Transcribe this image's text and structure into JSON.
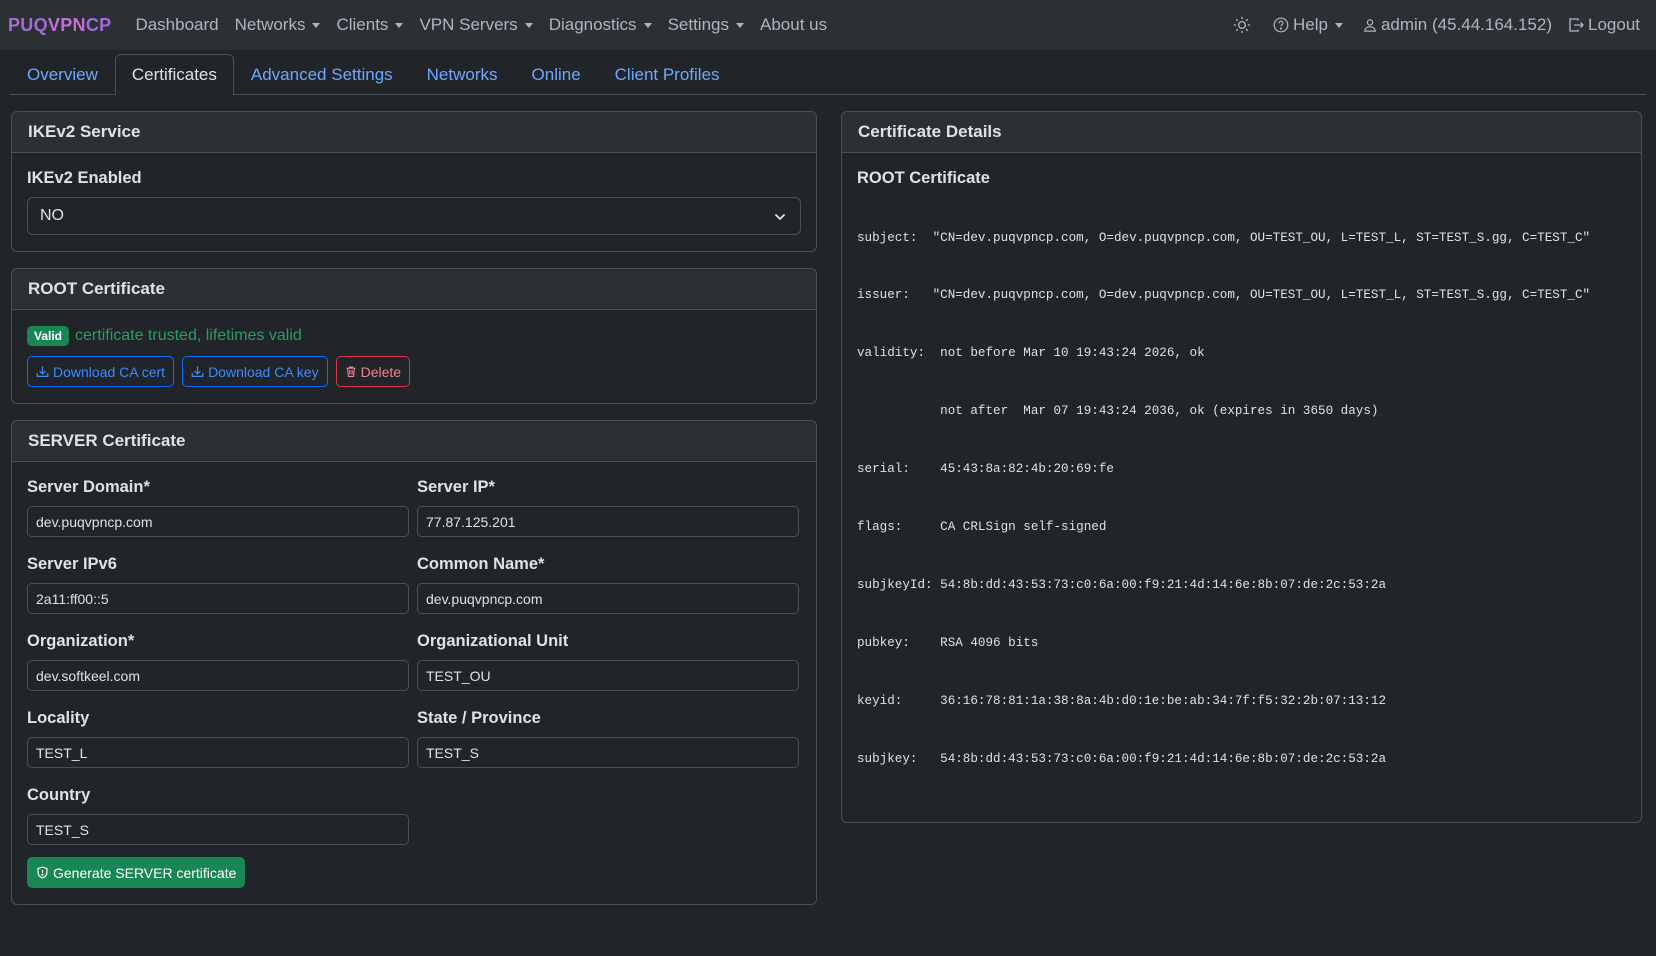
{
  "brand": {
    "part1": "PUQ",
    "part2": "VPN",
    "part3": "CP"
  },
  "nav": {
    "items": [
      {
        "label": "Dashboard",
        "dropdown": false
      },
      {
        "label": "Networks",
        "dropdown": true
      },
      {
        "label": "Clients",
        "dropdown": true
      },
      {
        "label": "VPN Servers",
        "dropdown": true
      },
      {
        "label": "Diagnostics",
        "dropdown": true
      },
      {
        "label": "Settings",
        "dropdown": true
      },
      {
        "label": "About us",
        "dropdown": false
      }
    ],
    "help_label": "Help",
    "user_label": "admin (45.44.164.152)",
    "logout_label": "Logout"
  },
  "tabs": [
    {
      "label": "Overview",
      "active": false
    },
    {
      "label": "Certificates",
      "active": true
    },
    {
      "label": "Advanced Settings",
      "active": false
    },
    {
      "label": "Networks",
      "active": false
    },
    {
      "label": "Online",
      "active": false
    },
    {
      "label": "Client Profiles",
      "active": false
    }
  ],
  "ikev2": {
    "title": "IKEv2 Service",
    "enabled_label": "IKEv2 Enabled",
    "enabled_value": "NO"
  },
  "root": {
    "title": "ROOT Certificate",
    "badge": "Valid",
    "status_text": "certificate trusted, lifetimes valid",
    "download_cert": "Download CA cert",
    "download_key": "Download CA key",
    "delete": "Delete"
  },
  "server": {
    "title": "SERVER Certificate",
    "fields": {
      "domain": {
        "label": "Server Domain*",
        "value": "dev.puqvpncp.com"
      },
      "ip": {
        "label": "Server IP*",
        "value": "77.87.125.201"
      },
      "ipv6": {
        "label": "Server IPv6",
        "value": "2a11:ff00::5"
      },
      "cn": {
        "label": "Common Name*",
        "value": "dev.puqvpncp.com"
      },
      "org": {
        "label": "Organization*",
        "value": "dev.softkeel.com"
      },
      "ou": {
        "label": "Organizational Unit",
        "value": "TEST_OU"
      },
      "locality": {
        "label": "Locality",
        "value": "TEST_L"
      },
      "state": {
        "label": "State / Province",
        "value": "TEST_S"
      },
      "country": {
        "label": "Country",
        "value": "TEST_S"
      }
    },
    "generate_button": "Generate SERVER certificate"
  },
  "details": {
    "title": "Certificate Details",
    "subtitle": "ROOT Certificate",
    "lines": [
      "subject:  \"CN=dev.puqvpncp.com, O=dev.puqvpncp.com, OU=TEST_OU, L=TEST_L, ST=TEST_S.gg, C=TEST_C\"",
      "issuer:   \"CN=dev.puqvpncp.com, O=dev.puqvpncp.com, OU=TEST_OU, L=TEST_L, ST=TEST_S.gg, C=TEST_C\"",
      "validity:  not before Mar 10 19:43:24 2026, ok",
      "           not after  Mar 07 19:43:24 2036, ok (expires in 3650 days)",
      "serial:    45:43:8a:82:4b:20:69:fe",
      "flags:     CA CRLSign self-signed",
      "subjkeyId: 54:8b:dd:43:53:73:c0:6a:00:f9:21:4d:14:6e:8b:07:de:2c:53:2a",
      "pubkey:    RSA 4096 bits",
      "keyid:     36:16:78:81:1a:38:8a:4b:d0:1e:be:ab:34:7f:f5:32:2b:07:13:12",
      "subjkey:   54:8b:dd:43:53:73:c0:6a:00:f9:21:4d:14:6e:8b:07:de:2c:53:2a"
    ]
  },
  "colors": {
    "background": "#212529",
    "navbar": "#2b3035",
    "link": "#6ea8fe",
    "success": "#198754",
    "danger": "#dc3545",
    "primary": "#0d6efd",
    "brand": "#a36bd8"
  }
}
